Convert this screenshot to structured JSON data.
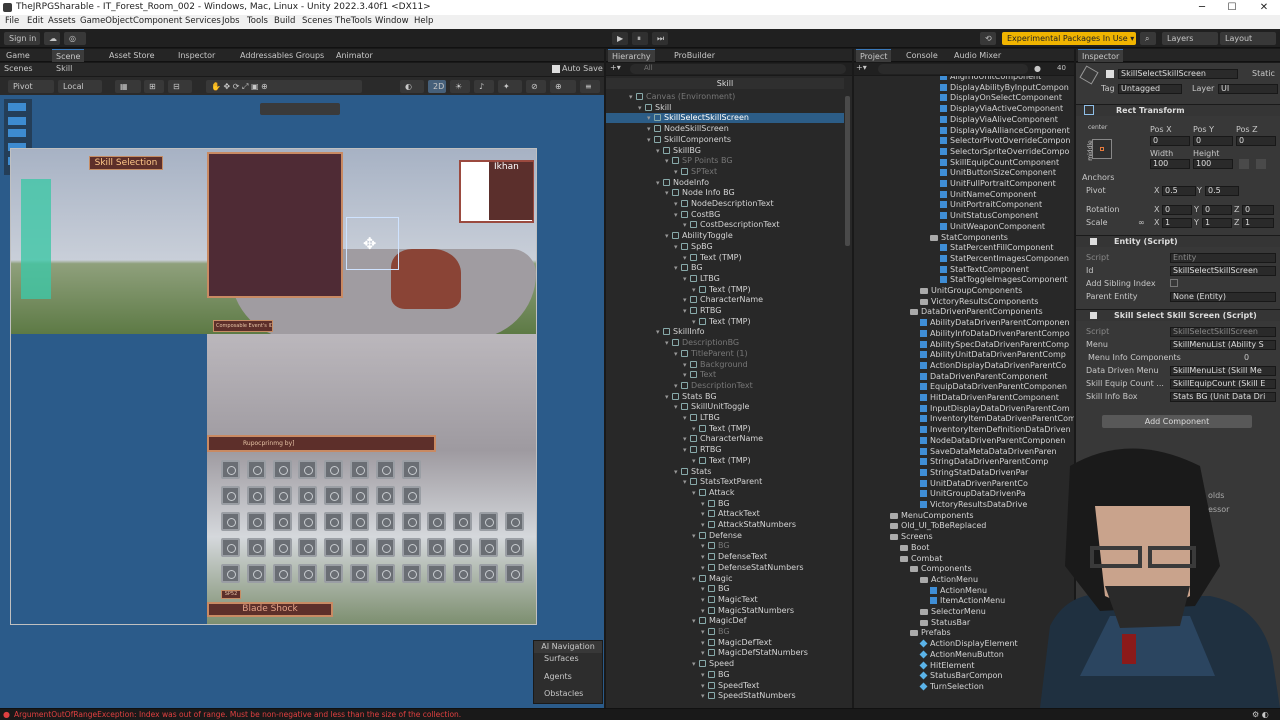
{
  "window": {
    "title": "TheJRPGSharable - IT_Forest_Room_002 - Windows, Mac, Linux - Unity 2022.3.40f1 <DX11>",
    "minimize": "─",
    "maximize": "☐",
    "close": "✕"
  },
  "menu": [
    "File",
    "Edit",
    "Assets",
    "GameObject",
    "Component",
    "Services",
    "Jobs",
    "Tools",
    "Build",
    "Scenes",
    "TheTools",
    "Window",
    "Help"
  ],
  "toolbar": {
    "sign_in": "Sign in",
    "play": "▶",
    "pause": "⏸",
    "step": "⏭",
    "experimental": "Experimental Packages In Use ▾",
    "layers": "Layers",
    "layout": "Layout"
  },
  "scene_panel": {
    "tabs": [
      "Game",
      "Scene",
      "Asset Store",
      "Inspector",
      "Addressables Groups",
      "Animator"
    ],
    "breadcrumb": [
      "Scenes",
      "Skill"
    ],
    "auto_save": "Auto Save",
    "pivot": "Pivot",
    "local": "Local",
    "mode_2d": "2D",
    "skill_selection_title": "Skill Selection",
    "char_name": "Ikhan",
    "cost_label": "Composable Event's ID",
    "desc_placeholder": "Rupocprinmg by]",
    "sp_label": "SP52",
    "skill_name": "Blade Shock",
    "overlay": {
      "title": "AI Navigation",
      "items": [
        "Surfaces",
        "Agents",
        "Obstacles"
      ]
    }
  },
  "hierarchy": {
    "tabs": [
      "Hierarchy",
      "ProBuilder"
    ],
    "search_placeholder": "All",
    "scene": "Skill",
    "rows": [
      {
        "t": "Canvas (Environment)",
        "d": 3,
        "dim": true
      },
      {
        "t": "Skill",
        "d": 4
      },
      {
        "t": "SkillSelectSkillScreen",
        "d": 5,
        "sel": true
      },
      {
        "t": "NodeSkillScreen",
        "d": 5
      },
      {
        "t": "SkillComponents",
        "d": 5
      },
      {
        "t": "SkillBG",
        "d": 6
      },
      {
        "t": "SP Points BG",
        "d": 7,
        "dim": true
      },
      {
        "t": "SPText",
        "d": 8,
        "dim": true
      },
      {
        "t": "NodeInfo",
        "d": 6
      },
      {
        "t": "Node Info BG",
        "d": 7
      },
      {
        "t": "NodeDescriptionText",
        "d": 8
      },
      {
        "t": "CostBG",
        "d": 8
      },
      {
        "t": "CostDescriptionText",
        "d": 9
      },
      {
        "t": "AbilityToggle",
        "d": 7
      },
      {
        "t": "SpBG",
        "d": 8
      },
      {
        "t": "Text (TMP)",
        "d": 9
      },
      {
        "t": "BG",
        "d": 8
      },
      {
        "t": "LTBG",
        "d": 9
      },
      {
        "t": "Text (TMP)",
        "d": 10
      },
      {
        "t": "CharacterName",
        "d": 9
      },
      {
        "t": "RTBG",
        "d": 9
      },
      {
        "t": "Text (TMP)",
        "d": 10
      },
      {
        "t": "SkillInfo",
        "d": 6
      },
      {
        "t": "DescriptionBG",
        "d": 7,
        "dim": true
      },
      {
        "t": "TitleParent (1)",
        "d": 8,
        "dim": true
      },
      {
        "t": "Background",
        "d": 9,
        "dim": true
      },
      {
        "t": "Text",
        "d": 9,
        "dim": true
      },
      {
        "t": "DescriptionText",
        "d": 8,
        "dim": true
      },
      {
        "t": "Stats BG",
        "d": 7
      },
      {
        "t": "SkillUnitToggle",
        "d": 8
      },
      {
        "t": "LTBG",
        "d": 9
      },
      {
        "t": "Text (TMP)",
        "d": 10
      },
      {
        "t": "CharacterName",
        "d": 9
      },
      {
        "t": "RTBG",
        "d": 9
      },
      {
        "t": "Text (TMP)",
        "d": 10
      },
      {
        "t": "Stats",
        "d": 8
      },
      {
        "t": "StatsTextParent",
        "d": 9
      },
      {
        "t": "Attack",
        "d": 10
      },
      {
        "t": "BG",
        "d": 11
      },
      {
        "t": "AttackText",
        "d": 11
      },
      {
        "t": "AttackStatNumbers",
        "d": 11
      },
      {
        "t": "Defense",
        "d": 10
      },
      {
        "t": "BG",
        "d": 11,
        "dim": true
      },
      {
        "t": "DefenseText",
        "d": 11
      },
      {
        "t": "DefenseStatNumbers",
        "d": 11
      },
      {
        "t": "Magic",
        "d": 10
      },
      {
        "t": "BG",
        "d": 11
      },
      {
        "t": "MagicText",
        "d": 11
      },
      {
        "t": "MagicStatNumbers",
        "d": 11
      },
      {
        "t": "MagicDef",
        "d": 10
      },
      {
        "t": "BG",
        "d": 11,
        "dim": true
      },
      {
        "t": "MagicDefText",
        "d": 11
      },
      {
        "t": "MagicDefStatNumbers",
        "d": 11
      },
      {
        "t": "Speed",
        "d": 10
      },
      {
        "t": "BG",
        "d": 11
      },
      {
        "t": "SpeedText",
        "d": 11
      },
      {
        "t": "SpeedStatNumbers",
        "d": 11
      }
    ]
  },
  "project": {
    "tabs": [
      "Project",
      "Console",
      "Audio Mixer"
    ],
    "count": "40",
    "rows": [
      {
        "t": "AlignToUnitComponent",
        "d": 8,
        "k": "s"
      },
      {
        "t": "DisplayAbilityByInputCompon",
        "d": 8,
        "k": "s"
      },
      {
        "t": "DisplayOnSelectComponent",
        "d": 8,
        "k": "s"
      },
      {
        "t": "DisplayViaActiveComponent",
        "d": 8,
        "k": "s"
      },
      {
        "t": "DisplayViaAliveComponent",
        "d": 8,
        "k": "s"
      },
      {
        "t": "DisplayViaAllianceComponent",
        "d": 8,
        "k": "s"
      },
      {
        "t": "SelectorPivotOverrideCompon",
        "d": 8,
        "k": "s"
      },
      {
        "t": "SelectorSpriteOverrideCompo",
        "d": 8,
        "k": "s"
      },
      {
        "t": "SkillEquipCountComponent",
        "d": 8,
        "k": "s"
      },
      {
        "t": "UnitButtonSizeComponent",
        "d": 8,
        "k": "s"
      },
      {
        "t": "UnitFullPortraitComponent",
        "d": 8,
        "k": "s"
      },
      {
        "t": "UnitNameComponent",
        "d": 8,
        "k": "s"
      },
      {
        "t": "UnitPortraitComponent",
        "d": 8,
        "k": "s"
      },
      {
        "t": "UnitStatusComponent",
        "d": 8,
        "k": "s"
      },
      {
        "t": "UnitWeaponComponent",
        "d": 8,
        "k": "s"
      },
      {
        "t": "StatComponents",
        "d": 7,
        "k": "f"
      },
      {
        "t": "StatPercentFillComponent",
        "d": 8,
        "k": "s"
      },
      {
        "t": "StatPercentImagesComponen",
        "d": 8,
        "k": "s"
      },
      {
        "t": "StatTextComponent",
        "d": 8,
        "k": "s"
      },
      {
        "t": "StatToggleImagesComponent",
        "d": 8,
        "k": "s"
      },
      {
        "t": "UnitGroupComponents",
        "d": 6,
        "k": "f"
      },
      {
        "t": "VictoryResultsComponents",
        "d": 6,
        "k": "f"
      },
      {
        "t": "DataDrivenParentComponents",
        "d": 5,
        "k": "f"
      },
      {
        "t": "AbilityDataDrivenParentComponen",
        "d": 6,
        "k": "s"
      },
      {
        "t": "AbilityInfoDataDrivenParentCompo",
        "d": 6,
        "k": "s"
      },
      {
        "t": "AbilitySpecDataDrivenParentComp",
        "d": 6,
        "k": "s"
      },
      {
        "t": "AbilityUnitDataDrivenParentComp",
        "d": 6,
        "k": "s"
      },
      {
        "t": "ActionDisplayDataDrivenParentCo",
        "d": 6,
        "k": "s"
      },
      {
        "t": "DataDrivenParentComponent",
        "d": 6,
        "k": "s"
      },
      {
        "t": "EquipDataDrivenParentComponen",
        "d": 6,
        "k": "s"
      },
      {
        "t": "HitDataDrivenParentComponent",
        "d": 6,
        "k": "s"
      },
      {
        "t": "InputDisplayDataDrivenParentCom",
        "d": 6,
        "k": "s"
      },
      {
        "t": "InventoryItemDataDrivenParentCom",
        "d": 6,
        "k": "s"
      },
      {
        "t": "InventoryItemDefinitionDataDriven",
        "d": 6,
        "k": "s"
      },
      {
        "t": "NodeDataDrivenParentComponen",
        "d": 6,
        "k": "s"
      },
      {
        "t": "SaveDataMetaDataDrivenParen",
        "d": 6,
        "k": "s"
      },
      {
        "t": "StringDataDrivenParentComp",
        "d": 6,
        "k": "s"
      },
      {
        "t": "StringStatDataDrivenPar",
        "d": 6,
        "k": "s"
      },
      {
        "t": "UnitDataDrivenParentCo",
        "d": 6,
        "k": "s"
      },
      {
        "t": "UnitGroupDataDrivenPa",
        "d": 6,
        "k": "s"
      },
      {
        "t": "VictoryResultsDataDrive",
        "d": 6,
        "k": "s"
      },
      {
        "t": "MenuComponents",
        "d": 3,
        "k": "f"
      },
      {
        "t": "Old_UI_ToBeReplaced",
        "d": 3,
        "k": "f"
      },
      {
        "t": "Screens",
        "d": 3,
        "k": "f"
      },
      {
        "t": "Boot",
        "d": 4,
        "k": "f"
      },
      {
        "t": "Combat",
        "d": 4,
        "k": "f"
      },
      {
        "t": "Components",
        "d": 5,
        "k": "f"
      },
      {
        "t": "ActionMenu",
        "d": 6,
        "k": "f"
      },
      {
        "t": "ActionMenu",
        "d": 7,
        "k": "s"
      },
      {
        "t": "ItemActionMenu",
        "d": 7,
        "k": "s"
      },
      {
        "t": "SelectorMenu",
        "d": 6,
        "k": "f"
      },
      {
        "t": "StatusBar",
        "d": 6,
        "k": "f"
      },
      {
        "t": "Prefabs",
        "d": 5,
        "k": "f"
      },
      {
        "t": "ActionDisplayElement",
        "d": 6,
        "k": "p"
      },
      {
        "t": "ActionMenuButton",
        "d": 6,
        "k": "p"
      },
      {
        "t": "HitElement",
        "d": 6,
        "k": "p"
      },
      {
        "t": "StatusBarCompon",
        "d": 6,
        "k": "p"
      },
      {
        "t": "TurnSelection",
        "d": 6,
        "k": "p"
      }
    ]
  },
  "inspector": {
    "tab": "Inspector",
    "object_name": "SkillSelectSkillScreen",
    "static": "Static",
    "tag_label": "Tag",
    "tag_value": "Untagged",
    "layer_label": "Layer",
    "layer_value": "UI",
    "rect_transform": "Rect Transform",
    "anchor_preset_top": "center",
    "anchor_preset_side": "middle",
    "pos_x_label": "Pos X",
    "pos_y_label": "Pos Y",
    "pos_z_label": "Pos Z",
    "pos_x": "0",
    "pos_y": "0",
    "pos_z": "0",
    "width_label": "Width",
    "height_label": "Height",
    "width": "100",
    "height": "100",
    "anchors": "Anchors",
    "pivot_label": "Pivot",
    "pivot_x": "0.5",
    "pivot_y": "0.5",
    "rotation_label": "Rotation",
    "rot_x": "0",
    "rot_y": "0",
    "rot_z": "0",
    "scale_label": "Scale",
    "scale_x": "1",
    "scale_y": "1",
    "scale_z": "1",
    "x_label": "X",
    "y_label": "Y",
    "z_label": "Z",
    "entity_script": "Entity (Script)",
    "script_label": "Script",
    "entity_script_value": "Entity",
    "id_label": "Id",
    "id_value": "SkillSelectSkillScreen",
    "add_sibling_label": "Add Sibling Index",
    "parent_entity_label": "Parent Entity",
    "parent_entity_value": "None (Entity)",
    "skill_script": "Skill Select Skill Screen (Script)",
    "skill_script_value": "SkillSelectSkillScreen",
    "menu_label": "Menu",
    "menu_value": "SkillMenuList (Ability S",
    "menu_info_label": "Menu Info Components",
    "menu_info_value": "0",
    "data_driven_label": "Data Driven Menu",
    "data_driven_value": "SkillMenuList (Skill Me",
    "skill_equip_label": "Skill Equip Count ...",
    "skill_equip_value": "SkillEquipCount (Skill E",
    "skill_info_label": "Skill Info Box",
    "skill_info_value": "Stats BG (Unit Data Dri",
    "add_component": "Add Component",
    "behind_1": "olds",
    "behind_2": "essor"
  },
  "status_error": "ArgumentOutOfRangeException: Index was out of range. Must be non-negative and less than the size of the collection."
}
